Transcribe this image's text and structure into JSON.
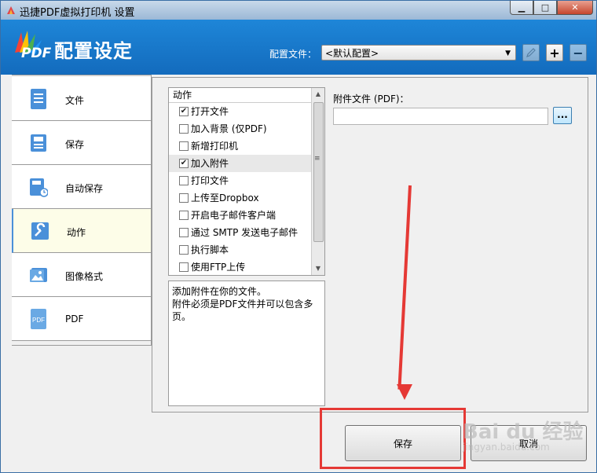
{
  "titlebar": {
    "title": "迅捷PDF虚拟打印机 设置",
    "min": "▁",
    "max": "□",
    "close": "✕"
  },
  "header": {
    "logo_text": "PDF",
    "title": "配置设定",
    "config_label": "配置文件：",
    "config_value": "<默认配置>",
    "add": "+",
    "remove": "−"
  },
  "sidebar": {
    "items": [
      {
        "label": "文件",
        "icon": "document-icon"
      },
      {
        "label": "保存",
        "icon": "save-icon"
      },
      {
        "label": "自动保存",
        "icon": "auto-save-icon"
      },
      {
        "label": "动作",
        "icon": "wrench-icon"
      },
      {
        "label": "图像格式",
        "icon": "image-icon"
      },
      {
        "label": "PDF",
        "icon": "pdf-icon"
      }
    ],
    "active_index": 3
  },
  "actions": {
    "header": "动作",
    "items": [
      {
        "label": "打开文件",
        "checked": true
      },
      {
        "label": "加入背景 (仅PDF)",
        "checked": false
      },
      {
        "label": "新增打印机",
        "checked": false
      },
      {
        "label": "加入附件",
        "checked": true
      },
      {
        "label": "打印文件",
        "checked": false
      },
      {
        "label": "上传至Dropbox",
        "checked": false
      },
      {
        "label": "开启电子邮件客户端",
        "checked": false
      },
      {
        "label": "通过 SMTP 发送电子邮件",
        "checked": false
      },
      {
        "label": "执行脚本",
        "checked": false
      },
      {
        "label": "使用FTP上传",
        "checked": false
      }
    ],
    "selected_index": 3,
    "description": "添加附件在你的文件。\n附件必须是PDF文件并可以包含多页。"
  },
  "attachment": {
    "label": "附件文件 (PDF)：",
    "value": "",
    "browse": "..."
  },
  "footer": {
    "save": "保存",
    "cancel": "取消"
  },
  "watermark": {
    "main": "Bai du 经验",
    "sub": "jingyan.baidu.com"
  },
  "colors": {
    "header_blue": "#1976c8",
    "annotation_red": "#e53935"
  }
}
